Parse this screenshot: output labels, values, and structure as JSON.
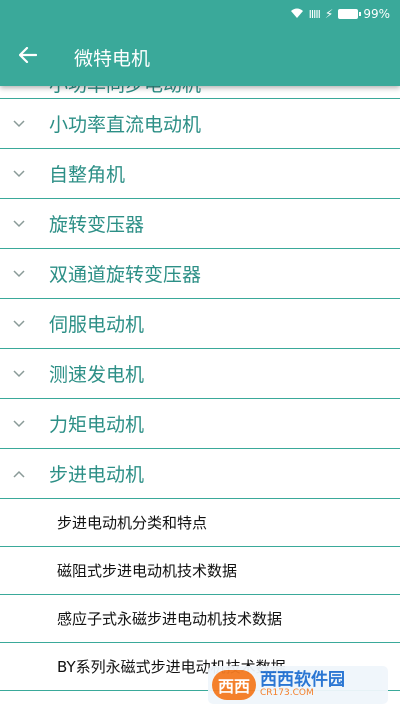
{
  "statusbar": {
    "battery_text": "99%",
    "signal": "IIIII",
    "bolt": "⚡"
  },
  "header": {
    "title": "微特电机"
  },
  "list": {
    "partial_top_label": "小功率同步电动机",
    "categories": [
      {
        "label": "小功率直流电动机",
        "expanded": false
      },
      {
        "label": "自整角机",
        "expanded": false
      },
      {
        "label": "旋转变压器",
        "expanded": false
      },
      {
        "label": "双通道旋转变压器",
        "expanded": false
      },
      {
        "label": "伺服电动机",
        "expanded": false
      },
      {
        "label": "测速发电机",
        "expanded": false
      },
      {
        "label": "力矩电动机",
        "expanded": false
      },
      {
        "label": "步进电动机",
        "expanded": true
      }
    ],
    "sub_items": [
      "步进电动机分类和特点",
      "磁阻式步进电动机技术数据",
      "感应子式永磁步进电动机技术数据",
      "BY系列永磁式步进电动机技术数据"
    ]
  },
  "watermark": {
    "main": "西西软件园",
    "sub": "CR173.COM",
    "logo": "西西"
  },
  "colors": {
    "primary": "#3aa99a",
    "label": "#2c8f86"
  },
  "icons": {
    "back": "arrow-left-icon",
    "collapsed": "chevron-down-icon",
    "expanded": "chevron-up-icon"
  }
}
